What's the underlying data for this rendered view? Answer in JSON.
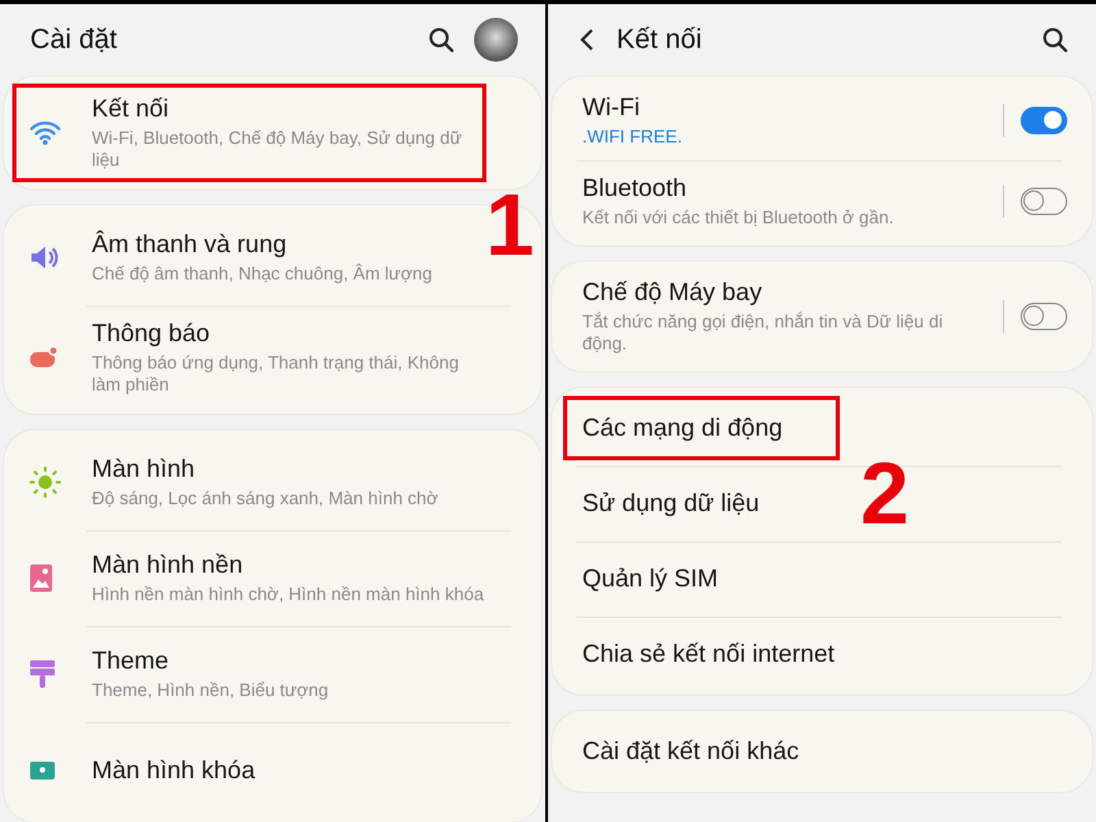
{
  "settings_screen": {
    "title": "Cài đặt",
    "groups": [
      {
        "items": [
          {
            "title": "Kết nối",
            "subtitle": "Wi-Fi, Bluetooth, Chế độ Máy bay, Sử dụng dữ liệu",
            "highlighted": true,
            "callout": "1"
          }
        ]
      },
      {
        "items": [
          {
            "title": "Âm thanh và rung",
            "subtitle": "Chế độ âm thanh, Nhạc chuông, Âm lượng",
            "highlighted": false
          },
          {
            "title": "Thông báo",
            "subtitle": "Thông báo ứng dụng, Thanh trạng thái, Không làm phiền",
            "highlighted": false
          }
        ]
      },
      {
        "items": [
          {
            "title": "Màn hình",
            "subtitle": "Độ sáng, Lọc ánh sáng xanh, Màn hình chờ",
            "highlighted": false
          },
          {
            "title": "Màn hình nền",
            "subtitle": "Hình nền màn hình chờ, Hình nền màn hình khóa",
            "highlighted": false
          },
          {
            "title": "Theme",
            "subtitle": "Theme, Hình nền, Biểu tượng",
            "highlighted": false
          },
          {
            "title": "Màn hình khóa",
            "highlighted": false
          }
        ]
      }
    ]
  },
  "connections_screen": {
    "title": "Kết nối",
    "groups": [
      {
        "items": [
          {
            "kind": "toggle",
            "title": "Wi-Fi",
            "status": ".WIFI FREE.",
            "on": true,
            "highlighted": false
          },
          {
            "kind": "toggle",
            "title": "Bluetooth",
            "subtitle": "Kết nối với các thiết bị Bluetooth ở gần.",
            "on": false,
            "highlighted": false
          }
        ]
      },
      {
        "items": [
          {
            "kind": "toggle",
            "title": "Chế độ Máy bay",
            "subtitle": "Tắt chức năng gọi điện, nhắn tin và Dữ liệu di động.",
            "on": false,
            "highlighted": false
          }
        ]
      },
      {
        "items": [
          {
            "kind": "link",
            "title": "Các mạng di động",
            "highlighted": true,
            "callout": "2"
          },
          {
            "kind": "link",
            "title": "Sử dụng dữ liệu",
            "highlighted": false
          },
          {
            "kind": "link",
            "title": "Quản lý SIM",
            "highlighted": false
          },
          {
            "kind": "link",
            "title": "Chia sẻ kết nối internet",
            "highlighted": false
          }
        ]
      },
      {
        "items": [
          {
            "kind": "link",
            "title": "Cài đặt kết nối khác",
            "highlighted": false
          }
        ]
      }
    ]
  }
}
